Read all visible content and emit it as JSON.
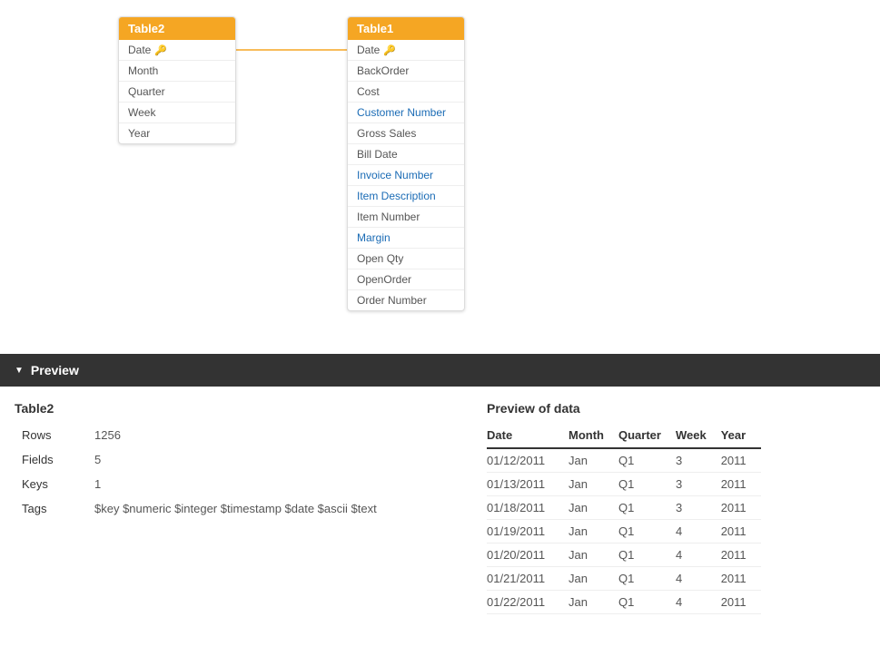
{
  "diagram": {
    "table2": {
      "title": "Table2",
      "fields": [
        {
          "name": "Date",
          "isKey": true
        },
        {
          "name": "Month",
          "isKey": false
        },
        {
          "name": "Quarter",
          "isKey": false
        },
        {
          "name": "Week",
          "isKey": false
        },
        {
          "name": "Year",
          "isKey": false
        }
      ]
    },
    "table1": {
      "title": "Table1",
      "fields": [
        {
          "name": "Date",
          "isKey": true
        },
        {
          "name": "BackOrder",
          "isKey": false
        },
        {
          "name": "Cost",
          "isKey": false
        },
        {
          "name": "Customer Number",
          "isKey": false
        },
        {
          "name": "Gross Sales",
          "isKey": false
        },
        {
          "name": "Bill Date",
          "isKey": false
        },
        {
          "name": "Invoice Number",
          "isKey": false
        },
        {
          "name": "Item Description",
          "isKey": false
        },
        {
          "name": "Item Number",
          "isKey": false
        },
        {
          "name": "Margin",
          "isKey": false
        },
        {
          "name": "Open Qty",
          "isKey": false
        },
        {
          "name": "OpenOrder",
          "isKey": false
        },
        {
          "name": "Order Number",
          "isKey": false
        }
      ]
    }
  },
  "preview": {
    "title": "Preview",
    "table_name": "Table2",
    "metadata": [
      {
        "label": "Rows",
        "value": "1256"
      },
      {
        "label": "Fields",
        "value": "5"
      },
      {
        "label": "Keys",
        "value": "1"
      },
      {
        "label": "Tags",
        "value": "$key $numeric $integer $timestamp $date $ascii $text"
      }
    ],
    "data_section_title": "Preview of data",
    "columns": [
      "Date",
      "Month",
      "Quarter",
      "Week",
      "Year"
    ],
    "rows": [
      [
        "01/12/2011",
        "Jan",
        "Q1",
        "3",
        "2011"
      ],
      [
        "01/13/2011",
        "Jan",
        "Q1",
        "3",
        "2011"
      ],
      [
        "01/18/2011",
        "Jan",
        "Q1",
        "3",
        "2011"
      ],
      [
        "01/19/2011",
        "Jan",
        "Q1",
        "4",
        "2011"
      ],
      [
        "01/20/2011",
        "Jan",
        "Q1",
        "4",
        "2011"
      ],
      [
        "01/21/2011",
        "Jan",
        "Q1",
        "4",
        "2011"
      ],
      [
        "01/22/2011",
        "Jan",
        "Q1",
        "4",
        "2011"
      ]
    ]
  }
}
